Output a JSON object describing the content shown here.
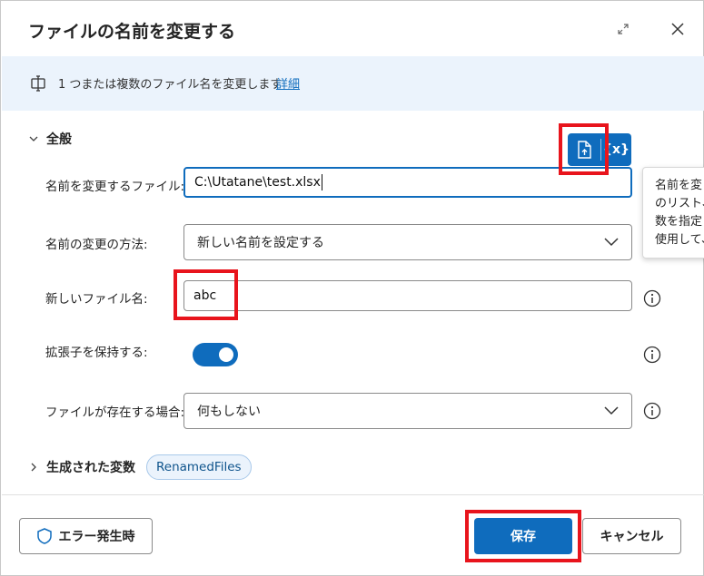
{
  "dialog": {
    "title": "ファイルの名前を変更する"
  },
  "info": {
    "text": "1 つまたは複数のファイル名を変更します",
    "link": "詳細"
  },
  "general": {
    "title": "全般"
  },
  "fields": {
    "file_label": "名前を変更するファイル:",
    "file_value": "C:\\Utatane\\test.xlsx",
    "method_label": "名前の変更の方法:",
    "method_value": "新しい名前を設定する",
    "newname_label": "新しいファイル名:",
    "newname_value": "abc",
    "keepext_label": "拡張子を保持する:",
    "keepext_on": true,
    "exists_label": "ファイルが存在する場合:",
    "exists_value": "何もしない"
  },
  "var_button": {
    "icon": "file-upload-icon",
    "symbol": "{x}"
  },
  "tooltip": {
    "lines": [
      "名前を変",
      "のリスト、",
      "数を指定",
      "使用して、"
    ]
  },
  "variables": {
    "title": "生成された変数",
    "chip": "RenamedFiles"
  },
  "footer": {
    "error_label": "エラー発生時",
    "save_label": "保存",
    "cancel_label": "キャンセル"
  },
  "colors": {
    "accent": "#0f6cbd",
    "info_bg": "#ebf3fc",
    "highlight": "#e8141c"
  }
}
